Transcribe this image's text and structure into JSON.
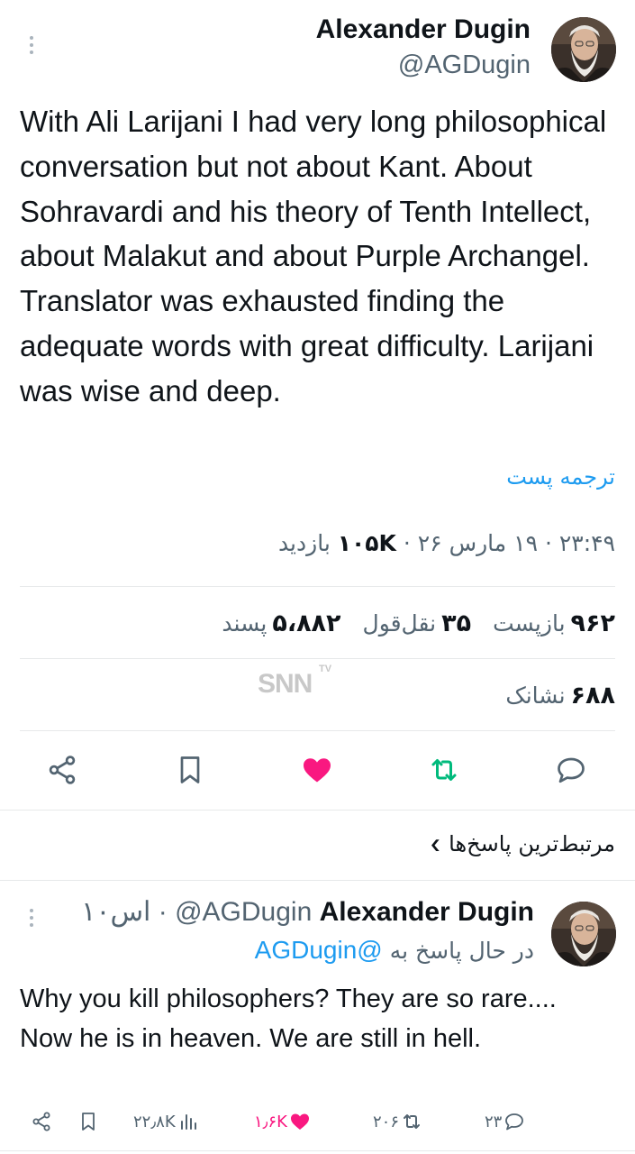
{
  "tweet": {
    "author_name": "Alexander Dugin",
    "author_handle": "@AGDugin",
    "text": "With Ali Larijani I had very long philosophical conversation but not about Kant. About Sohravardi and his theory of Tenth Intellect, about Malakut and about Purple Archangel. Translator was exhausted finding the adequate words with great difficulty. Larijani was wise and deep.",
    "translate_label": "ترجمه پست",
    "time": "۲۳:۴۹",
    "date": "۱۹ مارس ۲۶",
    "views_count": "۱۰۵K",
    "views_label": "بازدید",
    "separator": "·"
  },
  "stats": {
    "reposts_count": "۹۶۲",
    "reposts_label": "بازپست",
    "quotes_count": "۳۵",
    "quotes_label": "نقل‌قول",
    "likes_count": "۵،۸۸۲",
    "likes_label": "پسند",
    "bookmarks_count": "۶۸۸",
    "bookmarks_label": "نشانک"
  },
  "watermark": {
    "text": "SNN",
    "sub": "TV"
  },
  "icons": {
    "share": "share-icon",
    "bookmark": "bookmark-icon",
    "like": "heart-filled-icon",
    "repost": "repost-icon",
    "reply": "reply-icon",
    "chevron": "chevron-down-icon"
  },
  "colors": {
    "like": "#f91880",
    "repost": "#00ba7c",
    "link": "#1d9bf0",
    "muted": "#536471"
  },
  "related": {
    "label": "مرتبط‌ترین پاسخ‌ها"
  },
  "reply": {
    "author_name": "Alexander Dugin",
    "author_handle": "@AGDugin",
    "time": "۱۰اس",
    "separator": "·",
    "replying_label": "در حال پاسخ به",
    "replying_handle": "@AGDugin",
    "text": "Why you kill philosophers? They are so rare.... Now he is in heaven. We are still in hell.",
    "views": "۲۲٫۸K",
    "likes": "۱٫۶K",
    "reposts": "۲۰۶",
    "replies": "۲۳"
  }
}
